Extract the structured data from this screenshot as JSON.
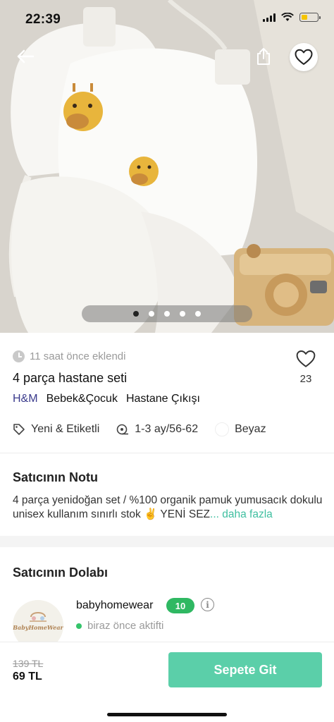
{
  "status_bar": {
    "time": "22:39"
  },
  "hero": {
    "icons": {
      "back": "arrow-left-icon",
      "share": "share-icon",
      "favorite": "heart-outline-icon"
    },
    "pager": {
      "count": 5,
      "active_index": 0
    }
  },
  "product": {
    "added": "11 saat önce eklendi",
    "title": "4 parça hastane seti",
    "likes": "23",
    "brand": "H&M",
    "categories": [
      "Bebek&Çocuk",
      "Hastane Çıkışı"
    ],
    "condition": "Yeni & Etiketli",
    "size": "1-3 ay/56-62",
    "color": "Beyaz"
  },
  "seller_note": {
    "title": "Satıcının Notu",
    "text": "4 parça yenidoğan set / %100 organik pamuk yumusacık dokulu unisex kullanım sınırlı stok ✌️ YENİ SEZ",
    "more": "... daha fazla"
  },
  "closet": {
    "title": "Satıcının Dolabı",
    "seller_name": "babyhomewear",
    "avatar_text": "BabyHomeWear",
    "level": "10",
    "status": "biraz önce aktifti"
  },
  "checkout": {
    "old_price": "139 TL",
    "price": "69 TL",
    "button_label": "Sepete Git"
  },
  "colors": {
    "accent": "#5bcfa9",
    "level_badge": "#2fb862",
    "brand": "#3a3a8c",
    "link": "#3fbfa0"
  }
}
